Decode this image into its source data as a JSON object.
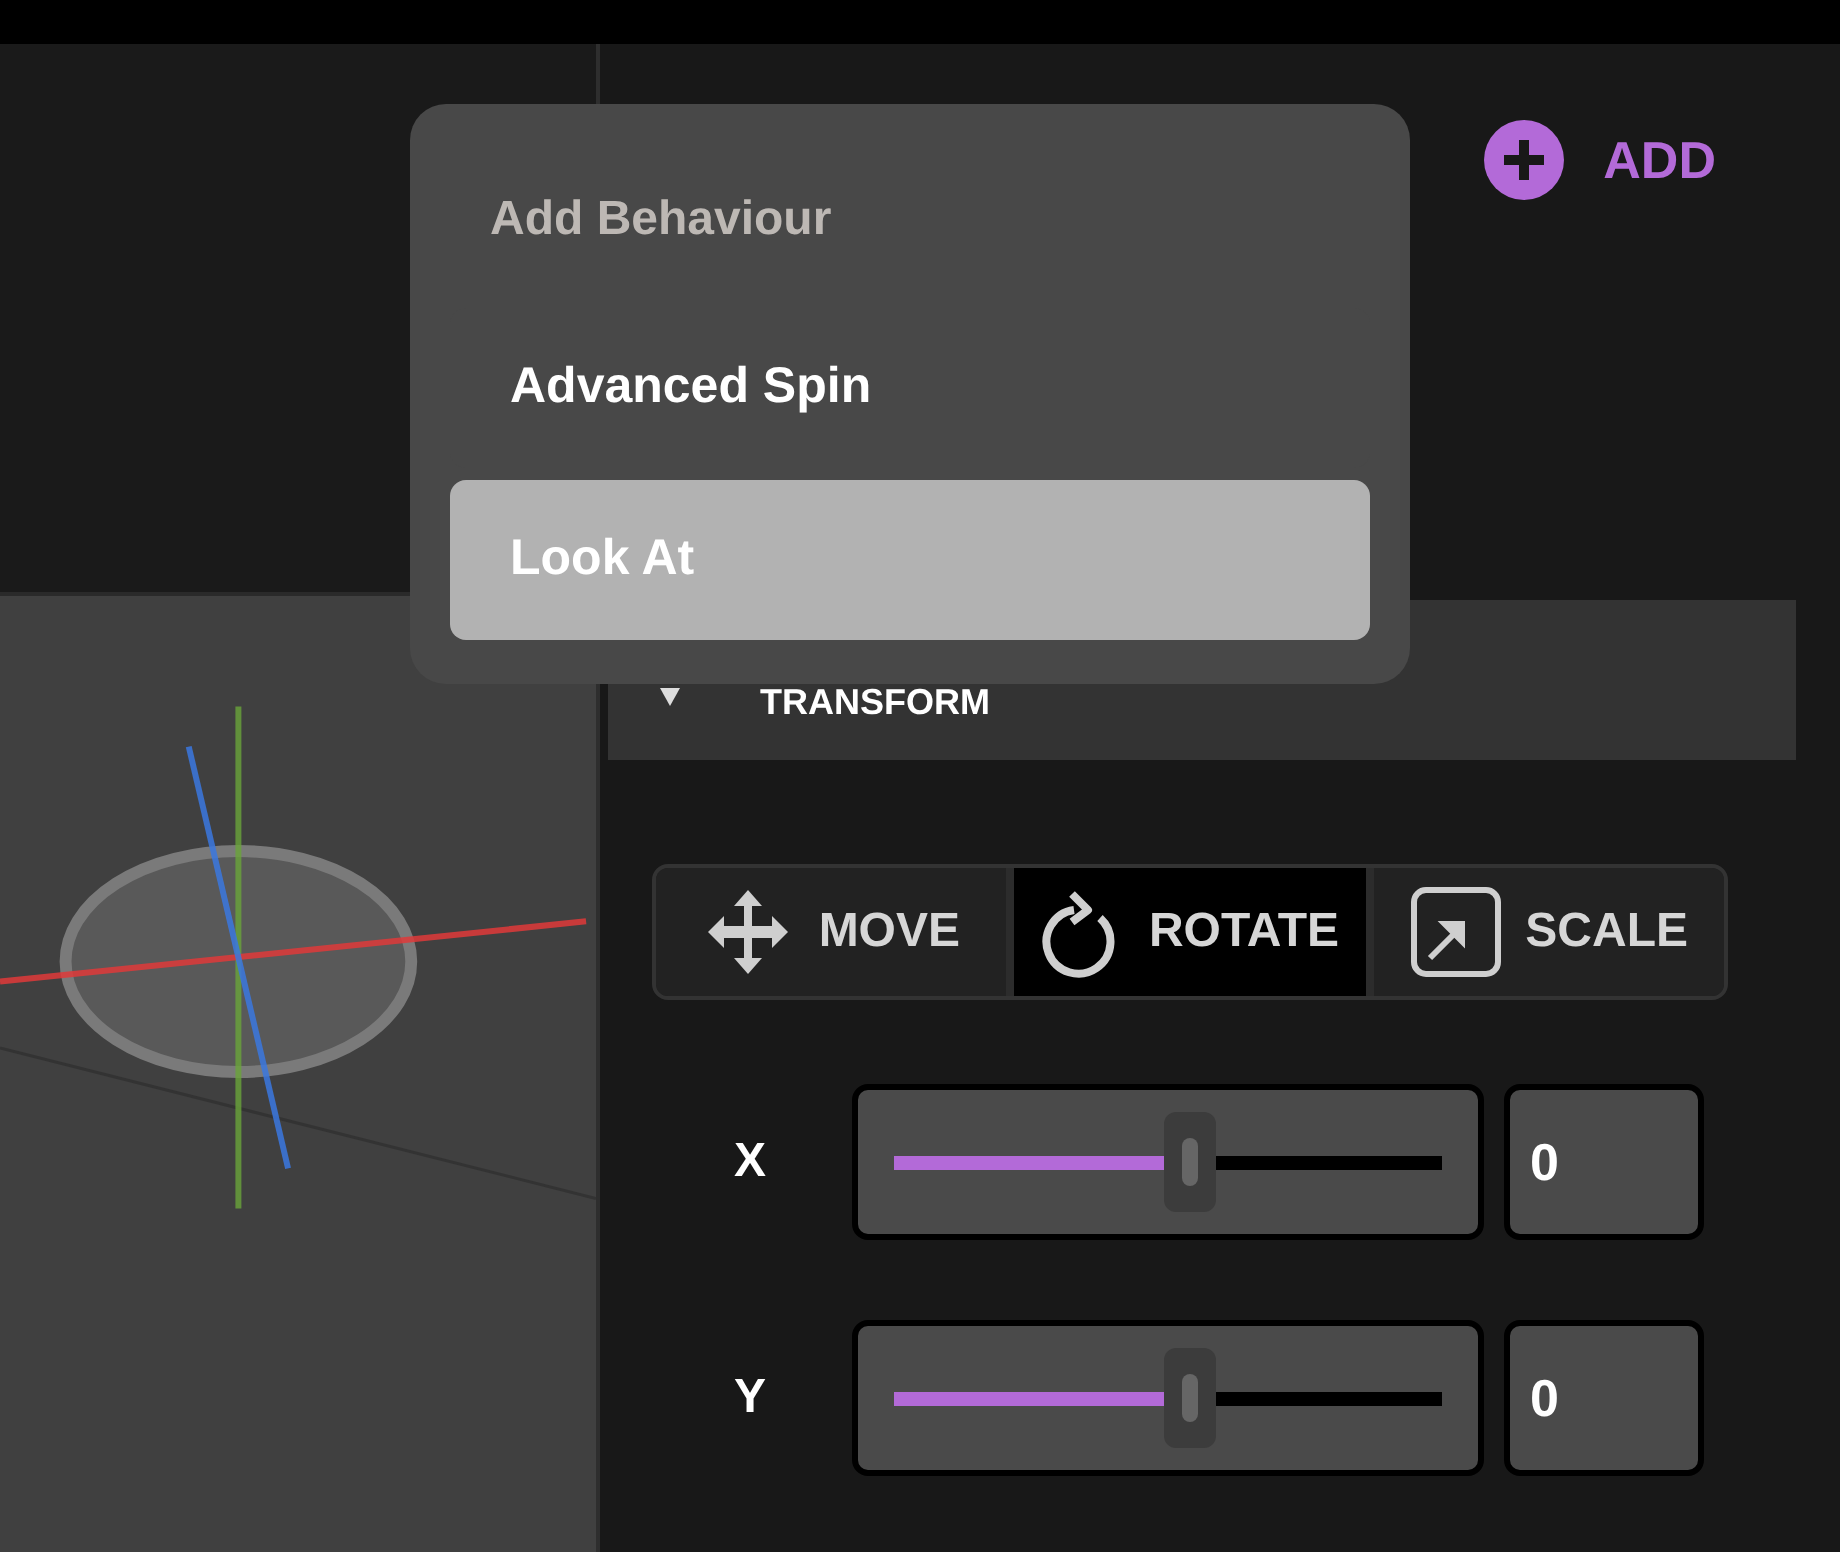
{
  "add_button": {
    "label": "ADD"
  },
  "section": {
    "title": "TRANSFORM",
    "expanded": true
  },
  "modes": [
    {
      "label": "MOVE",
      "kind": "move",
      "selected": false
    },
    {
      "label": "ROTATE",
      "kind": "rotate",
      "selected": true
    },
    {
      "label": "SCALE",
      "kind": "scale",
      "selected": false
    }
  ],
  "axes": [
    {
      "name": "X",
      "level": 0.5,
      "value": "0"
    },
    {
      "name": "Y",
      "level": 0.5,
      "value": "0"
    }
  ],
  "menu": {
    "title": "Add Behaviour",
    "items": [
      {
        "label": "Advanced Spin",
        "selected": false
      },
      {
        "label": "Look At",
        "selected": true
      }
    ]
  }
}
